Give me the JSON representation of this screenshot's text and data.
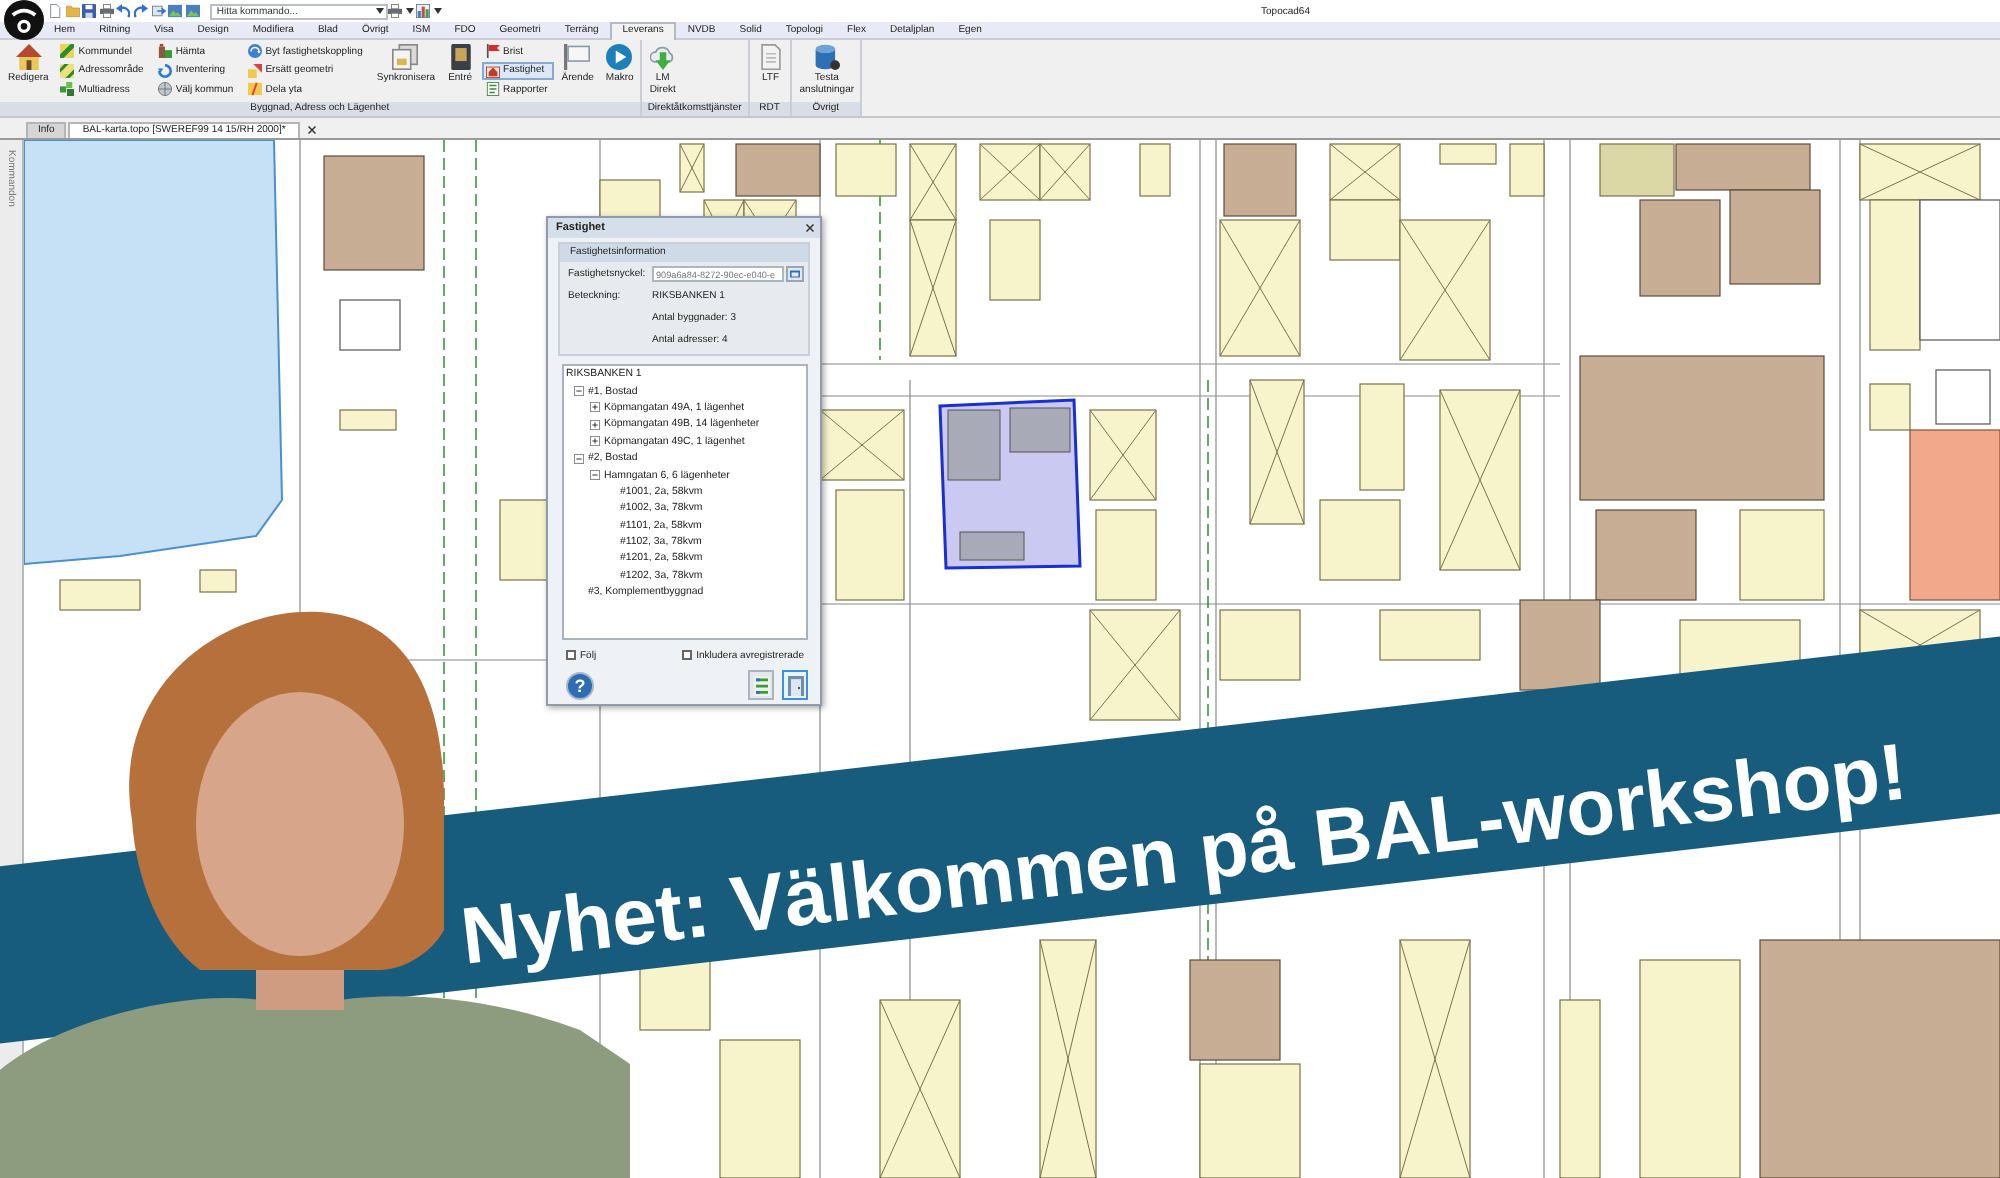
{
  "window": {
    "title": "Topocad64"
  },
  "quick_access": {
    "search": {
      "placeholder": "Hitta kommando..."
    }
  },
  "ribbon": {
    "tabs": [
      {
        "label": "Hem",
        "selected": false
      },
      {
        "label": "Ritning",
        "selected": false
      },
      {
        "label": "Visa",
        "selected": false
      },
      {
        "label": "Design",
        "selected": false
      },
      {
        "label": "Modifiera",
        "selected": false
      },
      {
        "label": "Blad",
        "selected": false
      },
      {
        "label": "Övrigt",
        "selected": false
      },
      {
        "label": "ISM",
        "selected": false
      },
      {
        "label": "FDO",
        "selected": false
      },
      {
        "label": "Geometri",
        "selected": false
      },
      {
        "label": "Terräng",
        "selected": false
      },
      {
        "label": "Leverans",
        "selected": true
      },
      {
        "label": "NVDB",
        "selected": false
      },
      {
        "label": "Solid",
        "selected": false
      },
      {
        "label": "Topologi",
        "selected": false
      },
      {
        "label": "Flex",
        "selected": false
      },
      {
        "label": "Detaljplan",
        "selected": false
      },
      {
        "label": "Egen",
        "selected": false
      }
    ],
    "groups": [
      {
        "label": "Byggnad, Adress och Lägenhet",
        "columns": [
          {
            "kind": "large",
            "label": "Redigera",
            "selected": false
          },
          {
            "kind": "stack",
            "items": [
              {
                "label": "Kommundel",
                "selected": false
              },
              {
                "label": "Adressområde",
                "selected": false
              },
              {
                "label": "Multiadress",
                "selected": false
              }
            ]
          },
          {
            "kind": "stack",
            "items": [
              {
                "label": "Hämta",
                "selected": false
              },
              {
                "label": "Inventering",
                "selected": false
              },
              {
                "label": "Välj kommun",
                "selected": false
              }
            ]
          },
          {
            "kind": "stack",
            "items": [
              {
                "label": "Byt fastighetskoppling",
                "selected": false
              },
              {
                "label": "Ersätt geometri",
                "selected": false
              },
              {
                "label": "Dela yta",
                "selected": false
              }
            ]
          },
          {
            "kind": "large",
            "label": "Synkronisera",
            "selected": false
          },
          {
            "kind": "large",
            "label": "Entré",
            "selected": false
          },
          {
            "kind": "stack",
            "items": [
              {
                "label": "Brist",
                "selected": false
              },
              {
                "label": "Fastighet",
                "selected": true
              },
              {
                "label": "Rapporter",
                "selected": false
              }
            ]
          },
          {
            "kind": "large",
            "label": "Ärende",
            "selected": false
          },
          {
            "kind": "large",
            "label": "Makro",
            "selected": false
          }
        ]
      },
      {
        "label": "Direktåtkomsttjänster",
        "columns": [
          {
            "kind": "large",
            "label": "LM Direkt",
            "selected": false
          }
        ]
      },
      {
        "label": "RDT",
        "columns": [
          {
            "kind": "large",
            "label": "LTF",
            "selected": false
          }
        ]
      },
      {
        "label": "Övrigt",
        "columns": [
          {
            "kind": "large",
            "label": "Testa anslutningar",
            "selected": false
          }
        ]
      }
    ]
  },
  "document_tabs": [
    {
      "label": "Info",
      "selected": false
    },
    {
      "label": "BAL-karta.topo [SWEREF99 14 15/RH 2000]*",
      "selected": true
    }
  ],
  "side_panel": {
    "title": "Kommandon"
  },
  "dialog": {
    "title": "Fastighet",
    "section": "Fastighetsinformation",
    "fields": [
      {
        "kind": "input",
        "label": "Fastighetsnyckel:",
        "value": "909a6a84-8272-90ec-e040-e"
      },
      {
        "kind": "text",
        "label": "Beteckning:",
        "value": "RIKSBANKEN 1"
      },
      {
        "kind": "text",
        "value": "Antal byggnader: 3"
      },
      {
        "kind": "text",
        "value": "Antal adresser: 4"
      }
    ],
    "tree": {
      "label": "RIKSBANKEN 1",
      "children": [
        {
          "label": "#1, Bostad",
          "expanded": true,
          "children": [
            {
              "label": "Köpmangatan 49A, 1 lägenhet",
              "expanded": false
            },
            {
              "label": "Köpmangatan 49B, 14 lägenheter",
              "expanded": false
            },
            {
              "label": "Köpmangatan 49C, 1 lägenhet",
              "expanded": false
            }
          ]
        },
        {
          "label": "#2, Bostad",
          "expanded": true,
          "children": [
            {
              "label": "Hamngatan 6, 6 lägenheter",
              "expanded": true,
              "children": [
                {
                  "label": "#1001, 2a, 58kvm"
                },
                {
                  "label": "#1002, 3a, 78kvm"
                },
                {
                  "label": "#1101, 2a, 58kvm"
                },
                {
                  "label": "#1102, 3a, 78kvm"
                },
                {
                  "label": "#1201, 2a, 58kvm"
                },
                {
                  "label": "#1202, 3a, 78kvm"
                }
              ]
            }
          ]
        },
        {
          "label": "#3, Komplementbyggnad"
        }
      ]
    },
    "checkboxes": [
      {
        "label": "Följ",
        "checked": false
      },
      {
        "label": "Inkludera avregistrerade",
        "checked": false
      }
    ],
    "help_button": "?",
    "buttons": [
      {
        "focused": false
      },
      {
        "focused": true
      }
    ]
  },
  "banner": {
    "text": "Nyhet: Välkommen på BAL-workshop!"
  }
}
